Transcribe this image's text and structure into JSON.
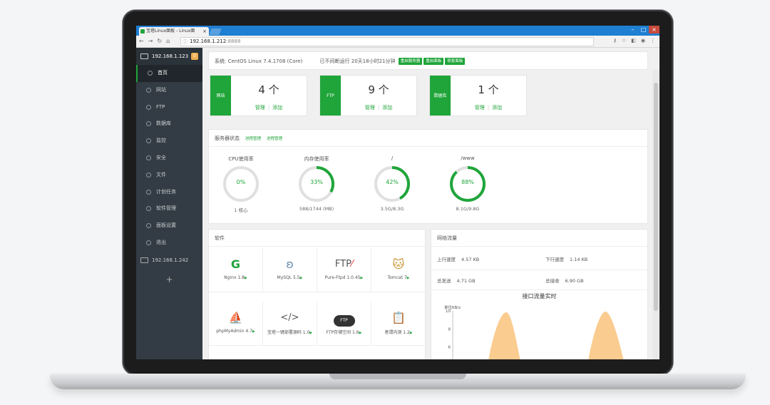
{
  "browser": {
    "tab_title": "宝塔Linux面板 - Linux面",
    "url_host": "192.168.1.212",
    "url_port": ":8888"
  },
  "sidebar": {
    "server_primary": "192.168.1.123",
    "badge": "0",
    "items": [
      {
        "label": "首页"
      },
      {
        "label": "网站"
      },
      {
        "label": "FTP"
      },
      {
        "label": "数据库"
      },
      {
        "label": "监控"
      },
      {
        "label": "安全"
      },
      {
        "label": "文件"
      },
      {
        "label": "计划任务"
      },
      {
        "label": "软件管理"
      },
      {
        "label": "面板设置"
      },
      {
        "label": "退出"
      }
    ],
    "server_secondary": "192.168.1.242",
    "add_label": "+"
  },
  "system": {
    "os_label": "系统:",
    "os_value": "CentOS Linux 7.4.1708 (Core)",
    "uptime_label": "已不间断运行",
    "uptime_value": "20天18小时21分钟",
    "buttons": [
      "重启服务器",
      "重启面板",
      "修复面板"
    ]
  },
  "stats": [
    {
      "label": "网站",
      "count": "4 个",
      "manage": "管理",
      "add": "添加"
    },
    {
      "label": "FTP",
      "count": "9 个",
      "manage": "管理",
      "add": "添加"
    },
    {
      "label": "数据库",
      "count": "1 个",
      "manage": "管理",
      "add": "添加"
    }
  ],
  "server_status": {
    "title": "服务器状态",
    "links": [
      "进程管理",
      "进程管理"
    ],
    "gauges": [
      {
        "title": "CPU使用率",
        "percent": "0%",
        "sub": "1 核心",
        "value": 0
      },
      {
        "title": "内存使用率",
        "percent": "33%",
        "sub": "588/1744 (MB)",
        "value": 33
      },
      {
        "title": "/",
        "percent": "42%",
        "sub": "3.5G/8.3G",
        "value": 42
      },
      {
        "title": "/www",
        "percent": "88%",
        "sub": "8.1G/9.8G",
        "value": 88
      }
    ],
    "ring_color": "#20a53a"
  },
  "software": {
    "title": "软件",
    "items": [
      {
        "name": "Nginx 1.8",
        "icon": "nginx-icon"
      },
      {
        "name": "MySQL 5.5",
        "icon": "mysql-icon"
      },
      {
        "name": "Pure-Ftpd 1.0.45",
        "icon": "ftp-icon"
      },
      {
        "name": "Tomcat 7",
        "icon": "tomcat-icon"
      },
      {
        "name": "phpMyAdmin 4.7",
        "icon": "phpmyadmin-icon"
      },
      {
        "name": "宝塔一键部署源码 1.0",
        "icon": "code-icon"
      },
      {
        "name": "FTP存储空间 1.6",
        "icon": "cloud-ftp-icon"
      },
      {
        "name": "者谓内测 1.2",
        "icon": "clipboard-icon"
      }
    ],
    "ftp_text": "FTP"
  },
  "network": {
    "title": "网络流量",
    "up_speed_label": "上行速度",
    "up_speed": "4.57 KB",
    "down_speed_label": "下行速度",
    "down_speed": "1.14 KB",
    "total_sent_label": "总发送",
    "total_sent": "4.71 GB",
    "total_recv_label": "总接收",
    "total_recv": "6.90 GB"
  },
  "chart_data": {
    "type": "area",
    "title": "接口流量实时",
    "ylabel": "单位KB/s",
    "y_ticks": [
      "10",
      "8",
      "6"
    ],
    "ylim": [
      4,
      10
    ],
    "fill_color": "#f9c784"
  }
}
